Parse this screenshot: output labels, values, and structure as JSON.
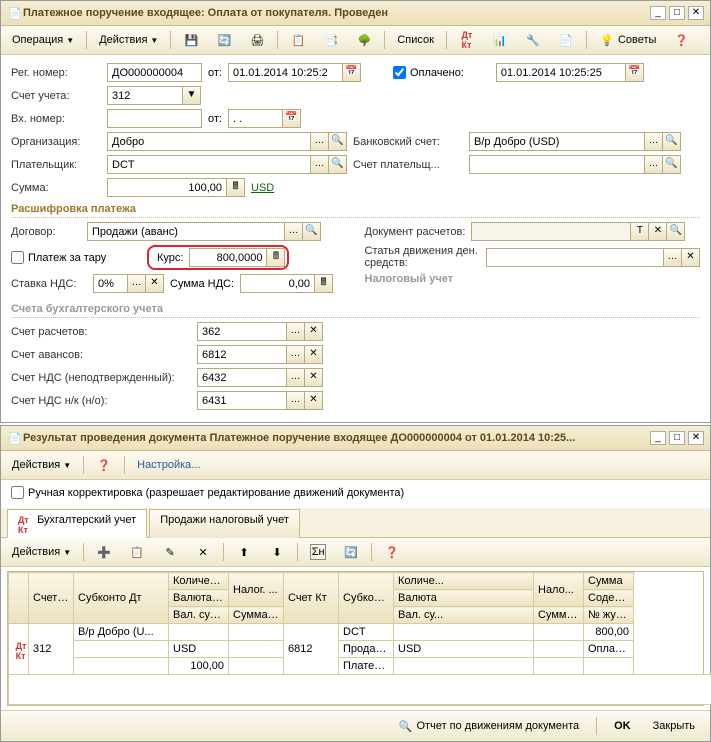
{
  "win1": {
    "title": "Платежное поручение входящее: Оплата от покупателя. Проведен",
    "toolbar": {
      "operation": "Операция",
      "actions": "Действия",
      "list": "Список",
      "advice": "Советы"
    },
    "labels": {
      "reg_no": "Рег. номер:",
      "from": "от:",
      "paid": "Оплачено:",
      "account": "Счет учета:",
      "in_no": "Вх. номер:",
      "org": "Организация:",
      "bank_acc": "Банковский счет:",
      "payer": "Плательщик:",
      "payer_acc": "Счет плательщ...",
      "sum": "Сумма:",
      "currency_link": "USD",
      "section_decode": "Расшифровка платежа",
      "contract": "Договор:",
      "payment_doc": "Документ расчетов:",
      "pay_tare": "Платеж за тару",
      "rate": "Курс:",
      "expense_item": "Статья движения ден. средств:",
      "vat_rate": "Ставка НДС:",
      "vat_sum": "Сумма НДС:",
      "tax_acc": "Налоговый учет",
      "section_accounts": "Счета бухгалтерского учета",
      "acc_settle": "Счет расчетов:",
      "acc_advance": "Счет авансов:",
      "acc_vat_unconf": "Счет НДС (неподтвержденный):",
      "acc_vat_nk": "Счет НДС н/к (н/о):"
    },
    "values": {
      "reg_no": "ДО000000004",
      "date": "01.01.2014 10:25:2",
      "paid_date": "01.01.2014 10:25:25",
      "account": "312",
      "in_no": "",
      "in_date": ". .",
      "org": "Добро",
      "bank_acc": "В/р Добро (USD)",
      "payer": "DCT",
      "payer_acc": "",
      "sum": "100,00",
      "contract": "Продажи (аванс)",
      "rate": "800,0000",
      "vat_rate": "0%",
      "vat_sum": "0,00",
      "acc_settle": "362",
      "acc_advance": "6812",
      "acc_vat_unconf": "6432",
      "acc_vat_nk": "6431"
    }
  },
  "win2": {
    "title": "Результат проведения документа Платежное поручение входящее ДО000000004 от 01.01.2014 10:25...",
    "toolbar": {
      "actions": "Действия",
      "settings": "Настройка..."
    },
    "manual_edit": "Ручная корректировка (разрешает редактирование движений документа)",
    "tabs": {
      "accounting": "Бухгалтерский учет",
      "tax": "Продажи налоговый учет"
    },
    "grid": {
      "headers": {
        "acc_dt": "Счет Дт",
        "sub_dt": "Субконто Дт",
        "qty": "Количест...",
        "cur_dt": "Валюта Дт",
        "cur_sum": "Вал. сум...",
        "tax": "Налог. ...",
        "sum_nu_dt": "Сумма (н/у) Дт",
        "acc_kt": "Счет Кт",
        "sub_kt": "Субконто Кт",
        "qty_k": "Количе...",
        "cur_kt": "Валюта",
        "cur_sum_k": "Вал. су...",
        "tax_k": "Нало...",
        "sum_nu_kt": "Сумма (н/у) Кт",
        "sum": "Сумма",
        "content": "Содержание",
        "journal": "№ журнала"
      },
      "row": {
        "acc_dt": "312",
        "sub_dt1": "В/р Добро (U...",
        "cur_dt": "USD",
        "cur_sum_dt": "100,00",
        "acc_kt": "6812",
        "sub_kt1": "DCT",
        "sub_kt2": "Продажи (аванс)",
        "sub_kt3": "Платежное поручение в...",
        "cur_kt": "USD",
        "sum": "800,00",
        "content": "Оплата (аванс)"
      }
    },
    "footer": {
      "report": "Отчет по движениям документа",
      "ok": "OK",
      "close": "Закрыть"
    }
  },
  "chart_data": null
}
